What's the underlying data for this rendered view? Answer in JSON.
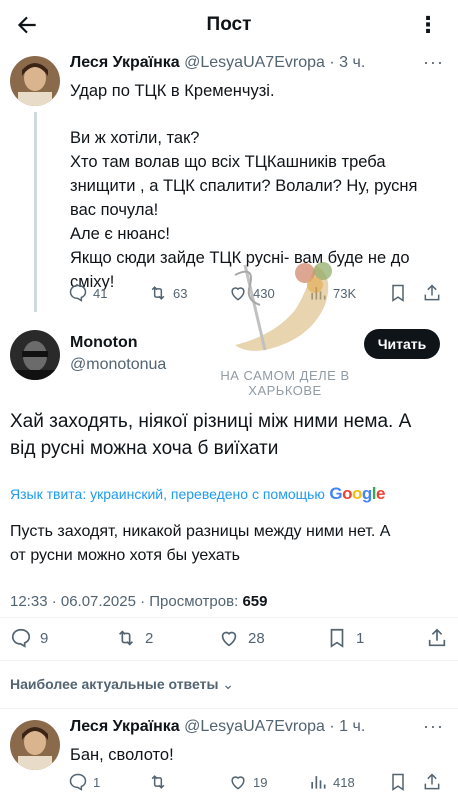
{
  "header": {
    "title": "Пост"
  },
  "tweet1": {
    "name": "Леся Українка",
    "handle": "@LesyaUA7Evropa",
    "time": "· 3 ч.",
    "lines": [
      "Удар по ТЦК в Кременчузі.",
      "",
      "Ви ж хотіли, так?",
      "Хто там волав що всіх ТЦКашників треба",
      "знищити , а ТЦК спалити? Волали? Ну, русня",
      "вас почула!",
      "Але є нюанс!",
      "Якщо сюди зайде ТЦК русні- вам буде не до",
      "сміху!"
    ],
    "replies": "41",
    "reposts": "63",
    "likes": "430",
    "views": "73K"
  },
  "watermark": {
    "line1": "НА САМОМ ДЕЛЕ В",
    "line2": "ХАРЬКОВЕ"
  },
  "main": {
    "name": "Monoton",
    "handle": "@monotonua",
    "follow": "Читать",
    "text_lines": [
      "Хай заходять, ніякої різниці між ними нема. А",
      "від русні можна хоча б виїхати"
    ],
    "translate_note": "Язык твита: украинский, переведено с помощью",
    "google": [
      "G",
      "o",
      "o",
      "g",
      "l",
      "e"
    ],
    "translated_lines": [
      "Пусть заходят, никакой разницы между ними нет. А",
      "от русни можно хотя бы уехать"
    ],
    "timestamp": "12:33 · 06.07.2025 · Просмотров:",
    "views": "659",
    "replies": "9",
    "reposts": "2",
    "likes": "28",
    "bookmarks": "1"
  },
  "sort_label": "Наиболее актуальные ответы",
  "reply": {
    "name": "Леся Українка",
    "handle": "@LesyaUA7Evropa",
    "time": "· 1 ч.",
    "text": "Бан, сволото!",
    "replies": "1",
    "reposts": "",
    "likes": "19",
    "views": "418"
  },
  "colors": {
    "accent": "#1d9bf0",
    "text": "#0f1419",
    "muted": "#536471"
  }
}
